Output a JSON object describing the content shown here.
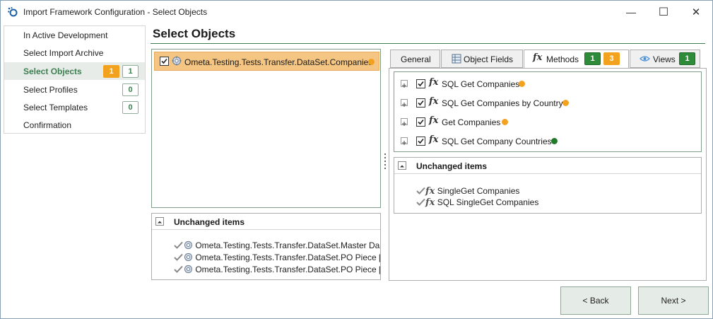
{
  "window": {
    "title": "Import Framework Configuration - Select Objects",
    "minimize_glyph": "—",
    "maximize_glyph": "☐",
    "close_glyph": "✕"
  },
  "nav": {
    "items": [
      {
        "label": "In Active Development"
      },
      {
        "label": "Select Import Archive"
      },
      {
        "label": "Select Objects",
        "active": true,
        "badge_changed": "1",
        "badge_count": "1"
      },
      {
        "label": "Select Profiles",
        "badge_count": "0"
      },
      {
        "label": "Select Templates",
        "badge_count": "0"
      },
      {
        "label": "Confirmation"
      }
    ]
  },
  "header": {
    "title": "Select Objects"
  },
  "objects": {
    "selected_item": {
      "label": "Ometa.Testing.Tests.Transfer.DataSet.Companies",
      "status_color": "#f3a21f"
    },
    "unchanged": {
      "title": "Unchanged items",
      "items": [
        "Ometa.Testing.Tests.Transfer.DataSet.Master Da",
        "Ometa.Testing.Tests.Transfer.DataSet.PO Piece [",
        "Ometa.Testing.Tests.Transfer.DataSet.PO Piece ["
      ]
    }
  },
  "tabs": {
    "general": {
      "label": "General"
    },
    "object_fields": {
      "label": "Object Fields"
    },
    "methods": {
      "label": "Methods",
      "badge_green": "1",
      "badge_orange": "3",
      "active": true
    },
    "views": {
      "label": "Views",
      "badge_green": "1"
    }
  },
  "methods": {
    "fx_glyph": "fx",
    "items": [
      {
        "label": "SQL Get Companies",
        "status_color": "#f3a21f"
      },
      {
        "label": "SQL Get Companies by Country",
        "status_color": "#f3a21f"
      },
      {
        "label": "Get Companies",
        "status_color": "#f3a21f"
      },
      {
        "label": "SQL Get Company Countries",
        "status_color": "#1f7a2a"
      }
    ],
    "unchanged": {
      "title": "Unchanged items",
      "items": [
        "SingleGet Companies",
        "SQL SingleGet Companies"
      ]
    }
  },
  "buttons": {
    "back": "< Back",
    "next": "Next >"
  },
  "colors": {
    "accent_green": "#3e7f52",
    "orange": "#f3a21f",
    "green_badge": "#2e8b3a"
  }
}
